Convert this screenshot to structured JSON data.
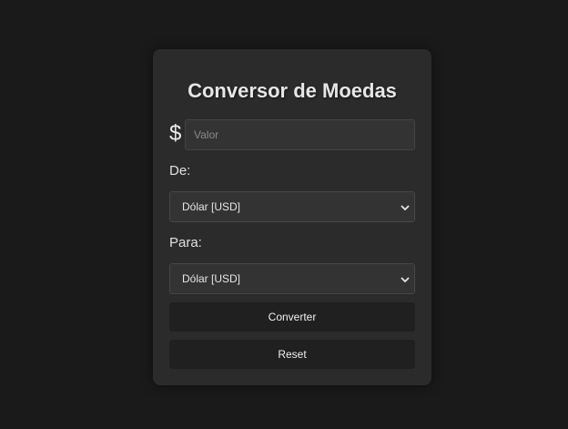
{
  "converter": {
    "title": "Conversor de Moedas",
    "currency_symbol": "$",
    "value_placeholder": "Valor",
    "value": "",
    "from_label": "De:",
    "from_selected": "Dólar [USD]",
    "to_label": "Para:",
    "to_selected": "Dólar [USD]",
    "convert_label": "Converter",
    "reset_label": "Reset"
  },
  "colors": {
    "page_background": "#1a1a1a",
    "card_background": "#2b2b2b",
    "field_background": "#333333",
    "button_background": "#202020",
    "text": "#e6e6e6"
  },
  "icons": {
    "select_arrow": "chevron-down-icon"
  }
}
